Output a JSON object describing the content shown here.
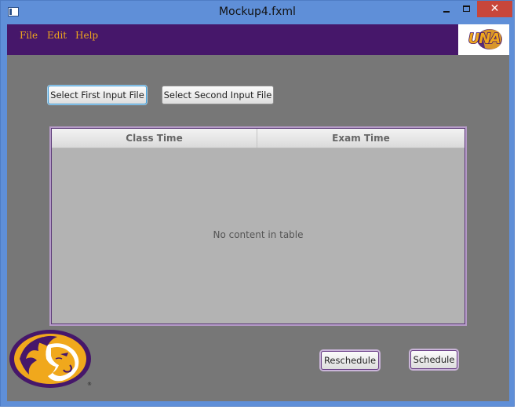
{
  "window": {
    "title": "Mockup4.fxml",
    "controls": {
      "minimize": "minimize-icon",
      "maximize": "maximize-icon",
      "close_glyph": "✕"
    }
  },
  "menubar": {
    "items": [
      {
        "label": "File"
      },
      {
        "label": "Edit"
      },
      {
        "label": "Help"
      }
    ],
    "background": "#46176a",
    "text_color": "#f0a81c"
  },
  "logo_top": {
    "text": "UNA",
    "brand_purple": "#46176a",
    "brand_gold": "#f0a81c"
  },
  "buttons": {
    "first_input": "Select First Input File",
    "second_input": "Select Second Input File",
    "reschedule": "Reschedule",
    "schedule": "Schedule"
  },
  "table": {
    "columns": [
      "Class Time",
      "Exam Time"
    ],
    "rows": [],
    "empty_message": "No content in table"
  },
  "logo_bottom": {
    "icon": "lion-head-icon",
    "mark": "®"
  },
  "colors": {
    "client_background": "#777777",
    "title_bar": "#5f8fd8",
    "close_button": "#c7463b"
  }
}
